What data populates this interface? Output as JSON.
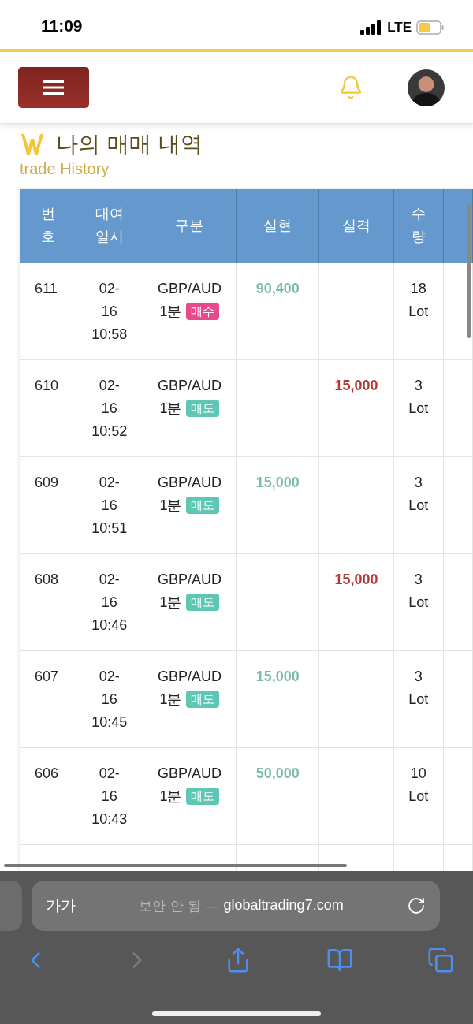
{
  "status_bar": {
    "time": "11:09",
    "network": "LTE"
  },
  "page": {
    "title": "나의 매매 내역",
    "subtitle": "trade History"
  },
  "table": {
    "columns": [
      "번호",
      "대여일시",
      "구분",
      "실현",
      "실격",
      "수량"
    ],
    "rows": [
      {
        "number": "611",
        "date": [
          "02-",
          "16",
          "10:58"
        ],
        "pair": "GBP/AUD",
        "period": "1분",
        "tag": {
          "label": "매수",
          "color": "#e8488c"
        },
        "realized": "90,400",
        "qty": "18 Lot"
      },
      {
        "number": "610",
        "date": [
          "02-",
          "16",
          "10:52"
        ],
        "pair": "GBP/AUD",
        "period": "1분",
        "tag": {
          "label": "매도",
          "color": "#5ec7b4"
        },
        "lost": "15,000",
        "qty": "3 Lot"
      },
      {
        "number": "609",
        "date": [
          "02-",
          "16",
          "10:51"
        ],
        "pair": "GBP/AUD",
        "period": "1분",
        "tag": {
          "label": "매도",
          "color": "#5ec7b4"
        },
        "realized": "15,000",
        "qty": "3 Lot"
      },
      {
        "number": "608",
        "date": [
          "02-",
          "16",
          "10:46"
        ],
        "pair": "GBP/AUD",
        "period": "1분",
        "tag": {
          "label": "매도",
          "color": "#5ec7b4"
        },
        "lost": "15,000",
        "qty": "3 Lot"
      },
      {
        "number": "607",
        "date": [
          "02-",
          "16",
          "10:45"
        ],
        "pair": "GBP/AUD",
        "period": "1분",
        "tag": {
          "label": "매도",
          "color": "#5ec7b4"
        },
        "realized": "15,000",
        "qty": "3 Lot"
      },
      {
        "number": "606",
        "date": [
          "02-",
          "16",
          "10:43"
        ],
        "pair": "GBP/AUD",
        "period": "1분",
        "tag": {
          "label": "매도",
          "color": "#5ec7b4"
        },
        "realized": "50,000",
        "qty": "10 Lot"
      }
    ]
  },
  "browser": {
    "text_size": "가가",
    "security_note": "보안 안 됨 —",
    "domain": "globaltrading7.com",
    "toolbar": [
      {
        "kind": "back",
        "disabled": false
      },
      {
        "kind": "forward",
        "disabled": true
      },
      {
        "kind": "share",
        "disabled": false
      },
      {
        "kind": "bookmarks",
        "disabled": false
      },
      {
        "kind": "tabs",
        "disabled": false
      }
    ]
  }
}
